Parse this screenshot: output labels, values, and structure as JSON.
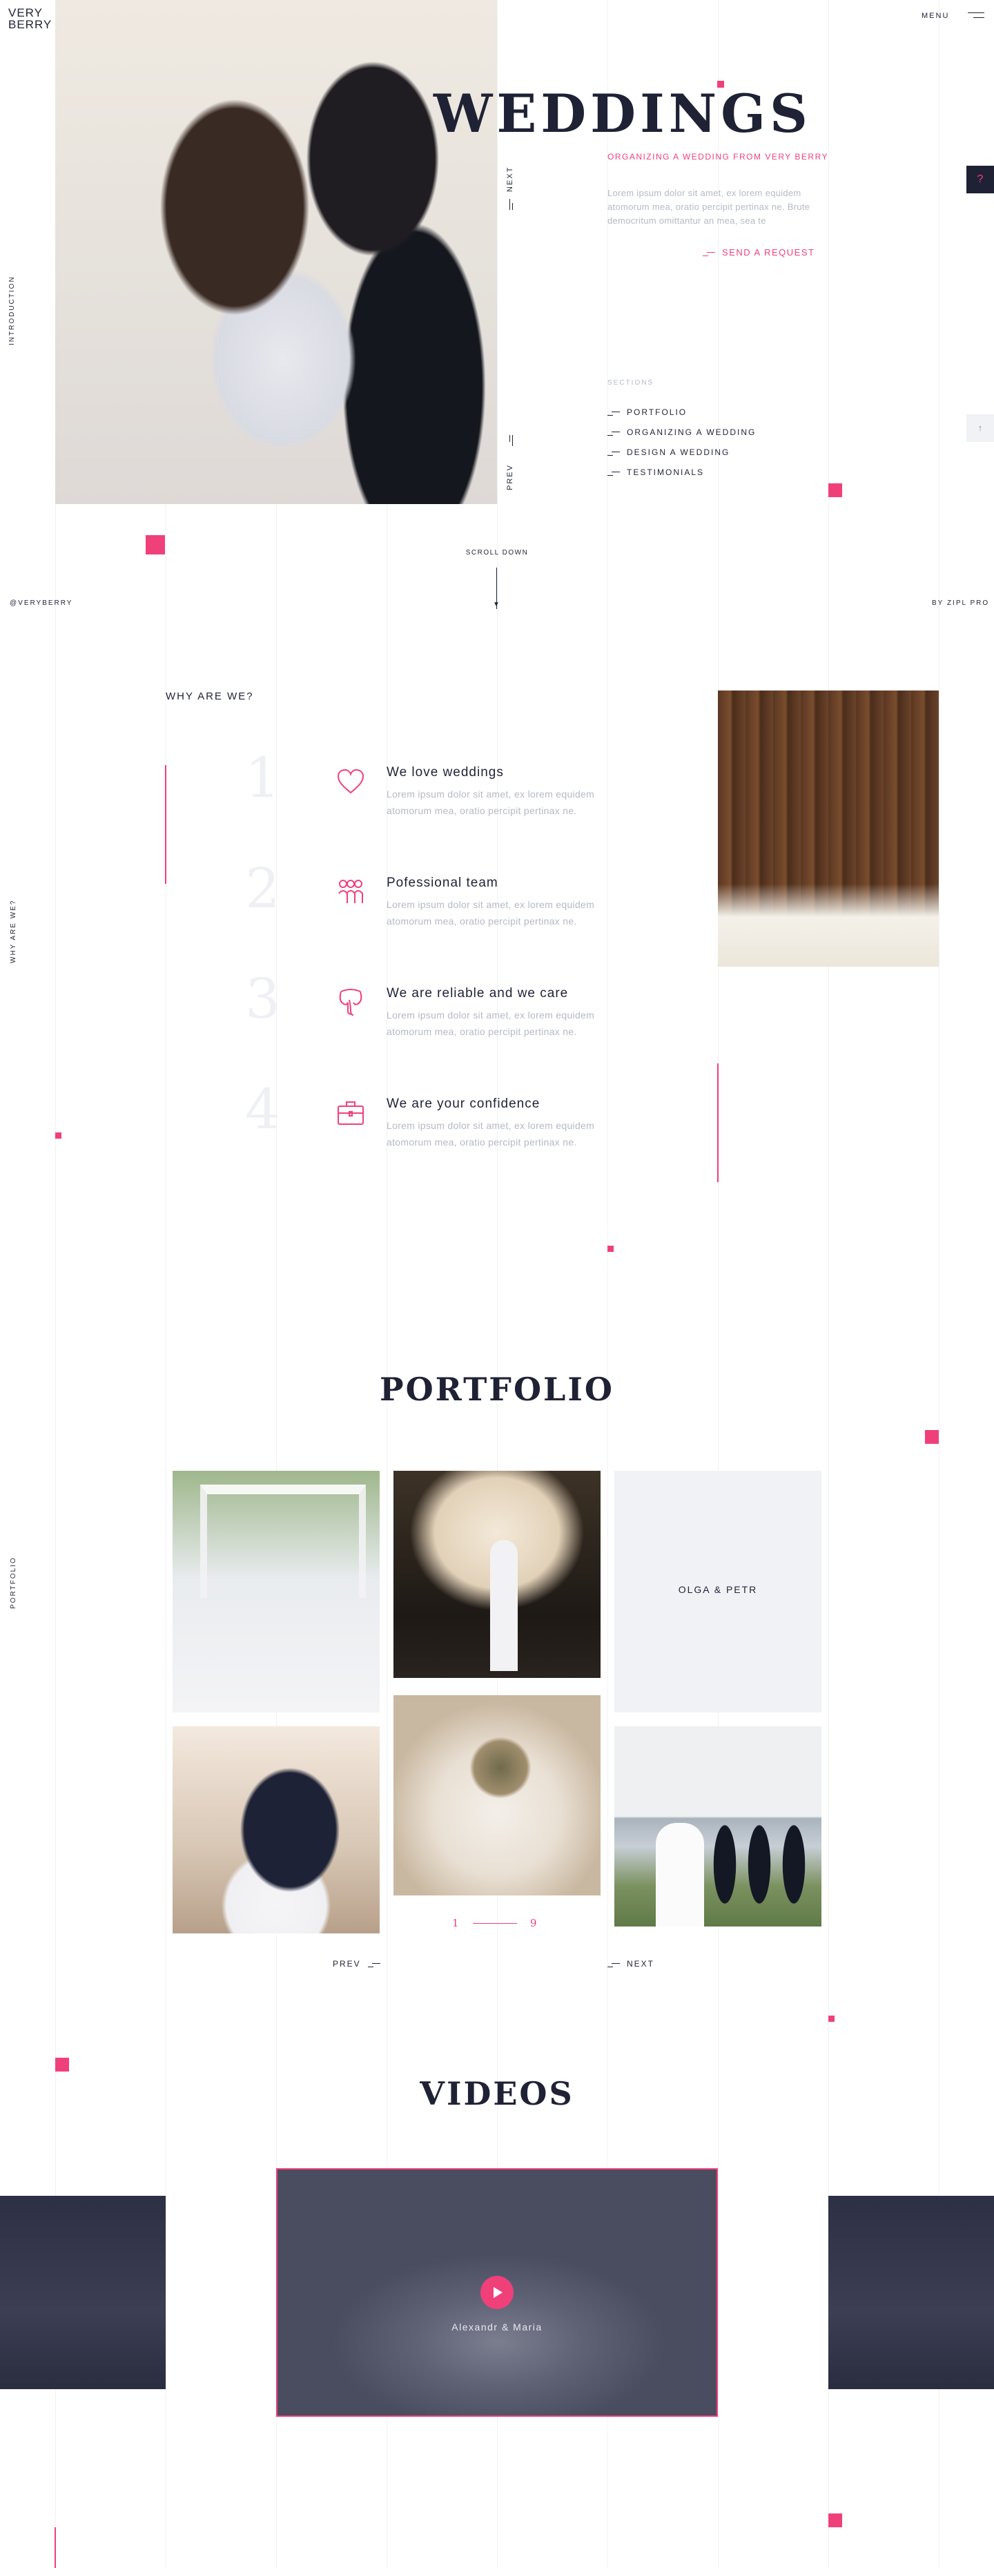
{
  "brand": {
    "logo_text": "VERY BERRY"
  },
  "header": {
    "menu_label": "MENU"
  },
  "side_labels": {
    "introduction": "INTRODUCTION",
    "why_are_we": "WHY ARE WE?",
    "portfolio": "PORTFOLIO",
    "handle": "@VERYBERRY",
    "credit": "BY ZIPL PRO"
  },
  "hero": {
    "title": "WEDDINGS",
    "subtitle": "ORGANIZING A WEDDING FROM VERY BERRY",
    "text": "Lorem ipsum dolor sit amet, ex lorem equidem atomorum mea, oratio percipit pertinax ne. Brute democritum omittantur an mea, sea te",
    "cta": "SEND A REQUEST",
    "next": "NEXT",
    "prev": "PREV",
    "sections_label": "SECTIONS",
    "sections": [
      "PORTFOLIO",
      "ORGANIZING A WEDDING",
      "DESIGN A WEDDING",
      "TESTIMONIALS"
    ],
    "help_button": "?",
    "up_button": "↑",
    "scroll_down": "SCROLL DOWN"
  },
  "why": {
    "heading": "WHY ARE WE?",
    "items": [
      {
        "num": "1",
        "icon": "heart-icon",
        "title": "We love weddings",
        "text": "Lorem ipsum dolor sit amet, ex lorem equidem atomorum mea, oratio percipit pertinax ne."
      },
      {
        "num": "2",
        "icon": "team-icon",
        "title": "Pofessional team",
        "text": "Lorem ipsum dolor sit amet, ex lorem equidem atomorum mea, oratio percipit pertinax ne."
      },
      {
        "num": "3",
        "icon": "elephant-icon",
        "title": "We are reliable and we care",
        "text": "Lorem ipsum dolor sit amet, ex lorem equidem atomorum mea, oratio percipit pertinax ne."
      },
      {
        "num": "4",
        "icon": "briefcase-icon",
        "title": "We are your confidence",
        "text": "Lorem ipsum dolor sit amet, ex lorem equidem atomorum mea, oratio percipit pertinax ne."
      }
    ]
  },
  "portfolio": {
    "heading": "PORTFOLIO",
    "featured_label": "OLGA & PETR",
    "pager_current": "1",
    "pager_total": "9",
    "prev": "PREV",
    "next": "NEXT"
  },
  "videos": {
    "heading": "VIDEOS",
    "caption": "Alexandr & Maria"
  },
  "colors": {
    "accent": "#f0407a",
    "dark": "#1f2235",
    "muted": "#b6b9c6",
    "panel": "#f1f2f6"
  }
}
